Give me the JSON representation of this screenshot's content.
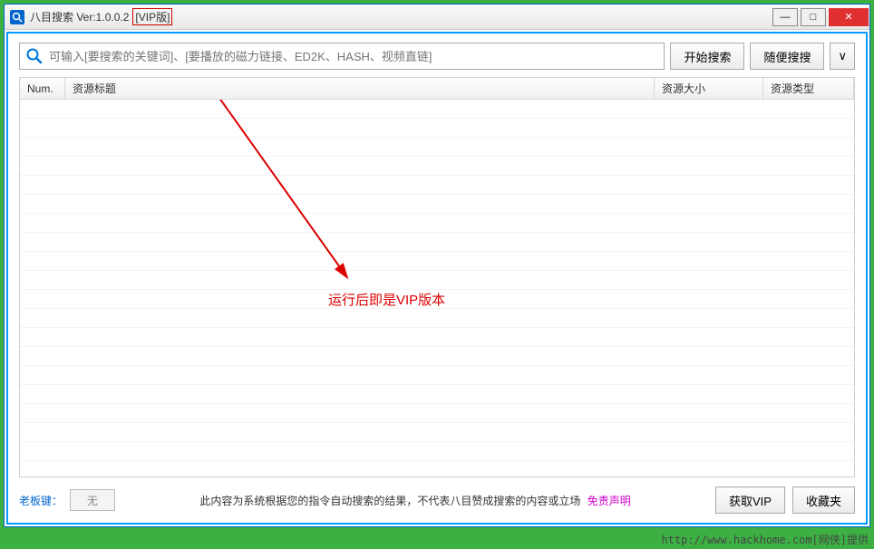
{
  "title": {
    "app_name": "八目搜索 Ver:1.0.0.2",
    "vip_badge": "[VIP版]"
  },
  "search": {
    "placeholder": "可输入[要搜索的关键词]、[要播放的磁力链接、ED2K、HASH、视频直链]",
    "start_btn": "开始搜索",
    "random_btn": "随便搜搜",
    "expand_btn": "∨"
  },
  "columns": {
    "num": "Num.",
    "title": "资源标题",
    "size": "资源大小",
    "type": "资源类型"
  },
  "annotation": {
    "text": "运行后即是VIP版本"
  },
  "bottom": {
    "bosskey_label": "老板键：",
    "bosskey_value": "无",
    "disclaimer": "此内容为系统根据您的指令自动搜索的结果，不代表八目赞成搜索的内容或立场",
    "disclaimer_link": "免责声明",
    "vip_btn": "获取VIP",
    "fav_btn": "收藏夹"
  },
  "footer_source": "http://www.hackhome.com[网侠]提供"
}
